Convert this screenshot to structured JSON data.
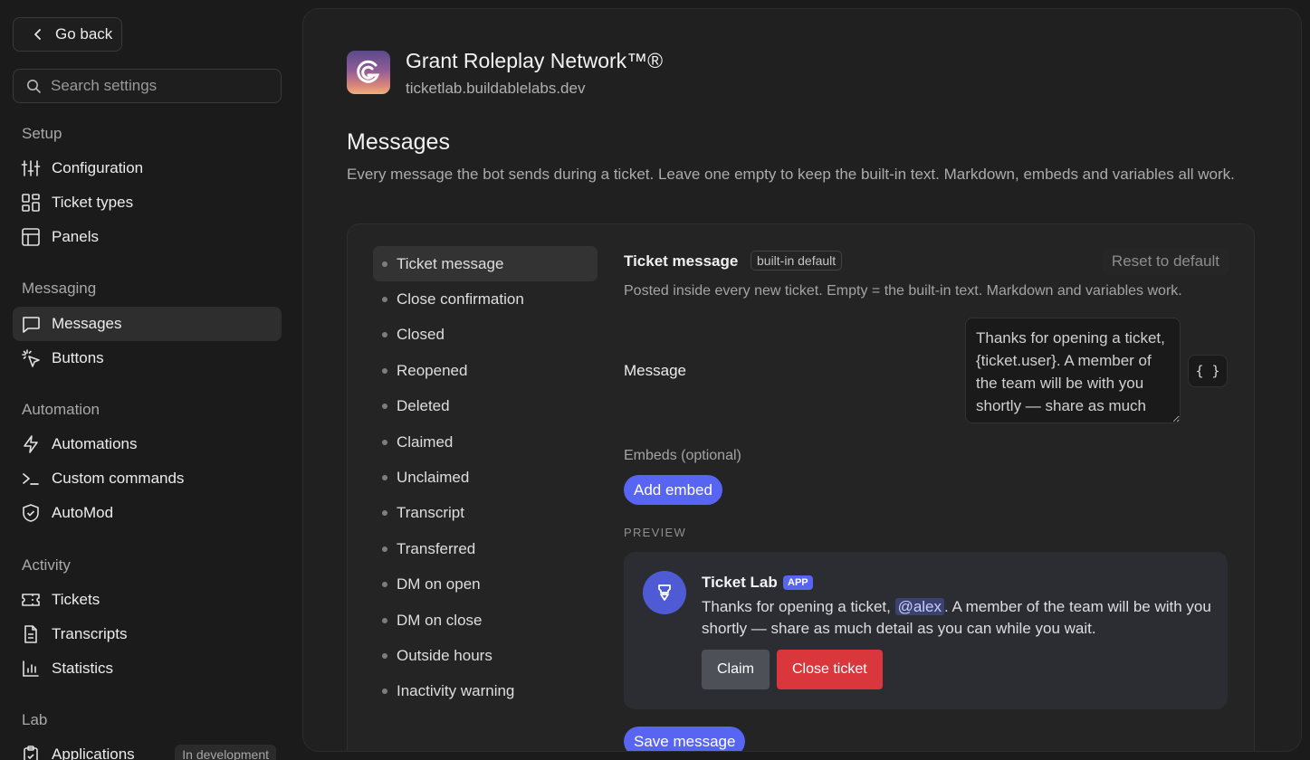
{
  "sidebar": {
    "go_back_label": "Go back",
    "search_placeholder": "Search settings",
    "sections": {
      "setup": "Setup",
      "messaging": "Messaging",
      "automation": "Automation",
      "activity": "Activity",
      "lab": "Lab"
    },
    "items": {
      "configuration": "Configuration",
      "ticket_types": "Ticket types",
      "panels": "Panels",
      "messages": "Messages",
      "buttons": "Buttons",
      "automations": "Automations",
      "custom_commands": "Custom commands",
      "automod": "AutoMod",
      "tickets": "Tickets",
      "transcripts": "Transcripts",
      "statistics": "Statistics",
      "applications": "Applications"
    },
    "applications_badge": "In development",
    "active_item": "messages"
  },
  "header": {
    "server_name": "Grant Roleplay Network™®",
    "server_domain": "ticketlab.buildablelabs.dev"
  },
  "page": {
    "title": "Messages",
    "description": "Every message the bot sends during a ticket. Leave one empty to keep the built-in text. Markdown, embeds and variables all work."
  },
  "message_types": [
    "Ticket message",
    "Close confirmation",
    "Closed",
    "Reopened",
    "Deleted",
    "Claimed",
    "Unclaimed",
    "Transcript",
    "Transferred",
    "DM on open",
    "DM on close",
    "Outside hours",
    "Inactivity warning"
  ],
  "selected_message_type": "Ticket message",
  "editor": {
    "title": "Ticket message",
    "badge": "built-in default",
    "reset_label": "Reset to default",
    "description": "Posted inside every new ticket. Empty = the built-in text. Markdown and variables work.",
    "message_label": "Message",
    "message_value": "Thanks for opening a ticket, {ticket.user}. A member of the team will be with you shortly — share as much detail as you can while you wait.",
    "variables_button": "{ }",
    "embeds_label": "Embeds (optional)",
    "add_embed_label": "Add embed",
    "preview_label": "PREVIEW",
    "save_label": "Save message"
  },
  "preview": {
    "bot_name": "Ticket Lab",
    "app_tag": "APP",
    "text_before": "Thanks for opening a ticket, ",
    "mention": "@alex",
    "text_after": ". A member of the team will be with you shortly — share as much detail as you can while you wait.",
    "claim_label": "Claim",
    "close_label": "Close ticket"
  },
  "colors": {
    "accent": "#5865f2",
    "danger": "#da373c",
    "secondary_button": "#4e5058"
  }
}
